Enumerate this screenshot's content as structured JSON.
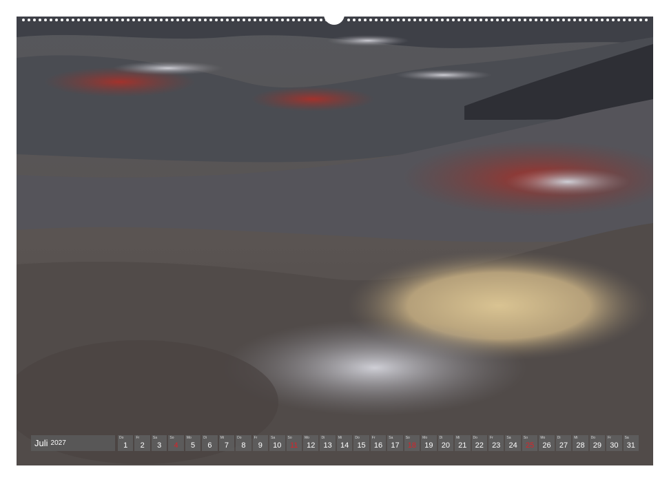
{
  "calendar": {
    "month": "Juli",
    "year": "2027",
    "days": [
      {
        "wd": "Do",
        "num": "1",
        "sun": false
      },
      {
        "wd": "Fr",
        "num": "2",
        "sun": false
      },
      {
        "wd": "Sa",
        "num": "3",
        "sun": false
      },
      {
        "wd": "So",
        "num": "4",
        "sun": true
      },
      {
        "wd": "Mo",
        "num": "5",
        "sun": false
      },
      {
        "wd": "Di",
        "num": "6",
        "sun": false
      },
      {
        "wd": "Mi",
        "num": "7",
        "sun": false
      },
      {
        "wd": "Do",
        "num": "8",
        "sun": false
      },
      {
        "wd": "Fr",
        "num": "9",
        "sun": false
      },
      {
        "wd": "Sa",
        "num": "10",
        "sun": false
      },
      {
        "wd": "So",
        "num": "11",
        "sun": true
      },
      {
        "wd": "Mo",
        "num": "12",
        "sun": false
      },
      {
        "wd": "Di",
        "num": "13",
        "sun": false
      },
      {
        "wd": "Mi",
        "num": "14",
        "sun": false
      },
      {
        "wd": "Do",
        "num": "15",
        "sun": false
      },
      {
        "wd": "Fr",
        "num": "16",
        "sun": false
      },
      {
        "wd": "Sa",
        "num": "17",
        "sun": false
      },
      {
        "wd": "So",
        "num": "18",
        "sun": true
      },
      {
        "wd": "Mo",
        "num": "19",
        "sun": false
      },
      {
        "wd": "Di",
        "num": "20",
        "sun": false
      },
      {
        "wd": "Mi",
        "num": "21",
        "sun": false
      },
      {
        "wd": "Do",
        "num": "22",
        "sun": false
      },
      {
        "wd": "Fr",
        "num": "23",
        "sun": false
      },
      {
        "wd": "Sa",
        "num": "24",
        "sun": false
      },
      {
        "wd": "So",
        "num": "25",
        "sun": true
      },
      {
        "wd": "Mo",
        "num": "26",
        "sun": false
      },
      {
        "wd": "Di",
        "num": "27",
        "sun": false
      },
      {
        "wd": "Mi",
        "num": "28",
        "sun": false
      },
      {
        "wd": "Do",
        "num": "29",
        "sun": false
      },
      {
        "wd": "Fr",
        "num": "30",
        "sun": false
      },
      {
        "wd": "Sa",
        "num": "31",
        "sun": false
      }
    ]
  },
  "colors": {
    "sunday": "#d8242a",
    "strip": "#5f5f5f"
  }
}
